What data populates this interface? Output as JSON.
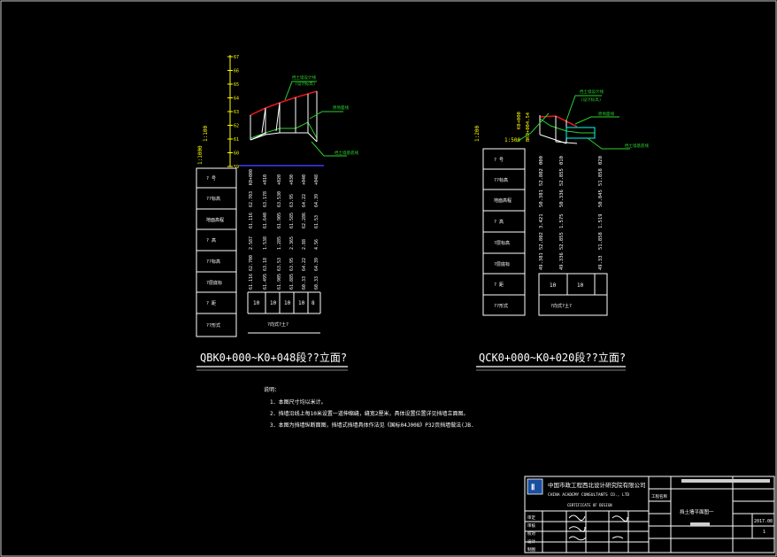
{
  "colors": {
    "background": "#000000",
    "frame": "#ffffff",
    "ground_line": "#ffffff",
    "design_line_red": "#e01818",
    "leader_green": "#2bd02b",
    "ruler_yellow": "#ffff00",
    "datum_blue": "#3a3aff",
    "logo_blue": "#1a4fa0"
  },
  "left": {
    "title": "QBK0+000~K0+048段??立面?",
    "ruler_ticks": [
      "67",
      "66",
      "65",
      "64",
      "63",
      "62",
      "61",
      "60",
      "59"
    ],
    "scale_v": "1:100",
    "scale_h": "1:1000",
    "row_headers": [
      "? 号",
      "??标高",
      "地面高程",
      "? 高",
      "??标高",
      "?层底标",
      "? 距",
      "??形式"
    ],
    "stations": [
      "K0+000",
      "+010",
      "+020",
      "+030",
      "+040",
      "+048"
    ],
    "rows": {
      "design_elev": [
        "62.703",
        "63.178",
        "63.530",
        "63.95",
        "64.22",
        "64.39"
      ],
      "ground_elev": [
        "61.116",
        "61.640",
        "61.905",
        "61.585",
        "62.286",
        "61.53"
      ],
      "height": [
        "2.587",
        "1.538",
        "1.285",
        "2.365",
        "2.88",
        "4.56"
      ],
      "top_elev": [
        "62.700",
        "63.18",
        "63.53",
        "63.95",
        "64.22",
        "64.39"
      ],
      "bottom_elev": [
        "61.116",
        "61.495",
        "61.905",
        "61.885",
        "60.33",
        "60.33"
      ],
      "spacing": [
        "10",
        "10",
        "10",
        "10",
        "8"
      ]
    },
    "wall_type": "?向式?土?",
    "annotations": [
      "挡土墙设计线",
      "(设计标高)",
      "原地面线",
      "挡土墙基底线"
    ]
  },
  "right": {
    "title": "QCK0+000~K0+020段??立面?",
    "scale_v": "1:200",
    "scale_h": "1:500",
    "row_headers": [
      "? 号",
      "??标高",
      "地面高程",
      "? 高",
      "?层标高",
      "?层底标",
      "? 距",
      "??形式"
    ],
    "side_label": "K0+000",
    "side_label2": "BK0+004.54",
    "rows": {
      "stations": [
        "000",
        "010",
        "020"
      ],
      "design_elev": [
        "52.802",
        "52.855",
        "51.858"
      ],
      "ground_elev": [
        "50.381",
        "50.336",
        "50.845"
      ],
      "height": [
        "3.421",
        "1.575",
        "1.519"
      ],
      "top_elev": [
        "52.802",
        "52.855",
        "51.858"
      ],
      "bottom_elev": [
        "49.381",
        "49.336",
        "49.33"
      ],
      "spacing": [
        "10",
        "10"
      ]
    },
    "wall_type": "?向式?土?",
    "annotations": [
      "挡土墙设计线",
      "(设计标高)",
      "原地面线",
      "挡土墙基底线"
    ]
  },
  "notes": {
    "heading": "说明：",
    "lines": [
      "1．本图尺寸均以米计。",
      "2．挡墙沿线上每10米设置一道伸缩缝，缝宽2厘米，具体设置位置详见挡墙立面图。",
      "3．本图为挡墙纵断面图，挡墙式挡墙具体作法见《国标04J008》P32页挡墙做法(JB."
    ]
  },
  "title_block": {
    "company_cn": "中国市政工程西北设计研究院有限公司",
    "company_en": "CHINA ACADEMY CONSULTANTS CO., LTD",
    "certificate": "CERTIFICATE OF DESIGN",
    "drawing_name": "挡土墙平面图一",
    "project_label": "工程名称",
    "date": "2017.08",
    "sheet_no": "1",
    "roles": [
      "审定",
      "审核",
      "校对",
      "设计",
      "制图"
    ]
  }
}
